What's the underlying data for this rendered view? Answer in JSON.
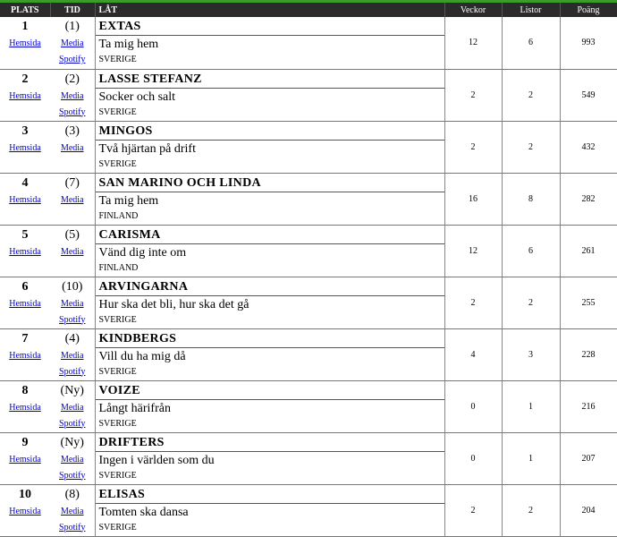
{
  "header": {
    "plats": "PLATS",
    "tid": "TID",
    "lat": "LÅT",
    "veckor": "Veckor",
    "listor": "Listor",
    "poang": "Poäng"
  },
  "link_labels": {
    "hemsida": "Hemsida",
    "media": "Media",
    "spotify": "Spotify"
  },
  "rows": [
    {
      "plats": "1",
      "tid": "(1)",
      "artist": "EXTAS",
      "song": "Ta mig hem",
      "country": "SVERIGE",
      "veckor": "12",
      "listor": "6",
      "poang": "993",
      "spotify": true
    },
    {
      "plats": "2",
      "tid": "(2)",
      "artist": "LASSE STEFANZ",
      "song": "Socker och salt",
      "country": "SVERIGE",
      "veckor": "2",
      "listor": "2",
      "poang": "549",
      "spotify": true
    },
    {
      "plats": "3",
      "tid": "(3)",
      "artist": "MINGOS",
      "song": "Två hjärtan på drift",
      "country": "SVERIGE",
      "veckor": "2",
      "listor": "2",
      "poang": "432",
      "spotify": false
    },
    {
      "plats": "4",
      "tid": "(7)",
      "artist": "SAN MARINO OCH LINDA",
      "song": "Ta mig hem",
      "country": "FINLAND",
      "veckor": "16",
      "listor": "8",
      "poang": "282",
      "spotify": false
    },
    {
      "plats": "5",
      "tid": "(5)",
      "artist": "CARISMA",
      "song": "Vänd dig inte om",
      "country": "FINLAND",
      "veckor": "12",
      "listor": "6",
      "poang": "261",
      "spotify": false
    },
    {
      "plats": "6",
      "tid": "(10)",
      "artist": "ARVINGARNA",
      "song": "Hur ska det bli, hur ska det gå",
      "country": "SVERIGE",
      "veckor": "2",
      "listor": "2",
      "poang": "255",
      "spotify": true
    },
    {
      "plats": "7",
      "tid": "(4)",
      "artist": "KINDBERGS",
      "song": "Vill du ha mig då",
      "country": "SVERIGE",
      "veckor": "4",
      "listor": "3",
      "poang": "228",
      "spotify": true
    },
    {
      "plats": "8",
      "tid": "(Ny)",
      "artist": "VOIZE",
      "song": "Långt härifrån",
      "country": "SVERIGE",
      "veckor": "0",
      "listor": "1",
      "poang": "216",
      "spotify": true
    },
    {
      "plats": "9",
      "tid": "(Ny)",
      "artist": "DRIFTERS",
      "song": "Ingen i världen som du",
      "country": "SVERIGE",
      "veckor": "0",
      "listor": "1",
      "poang": "207",
      "spotify": true
    },
    {
      "plats": "10",
      "tid": "(8)",
      "artist": "ELISAS",
      "song": "Tomten ska dansa",
      "country": "SVERIGE",
      "veckor": "2",
      "listor": "2",
      "poang": "204",
      "spotify": true
    }
  ]
}
